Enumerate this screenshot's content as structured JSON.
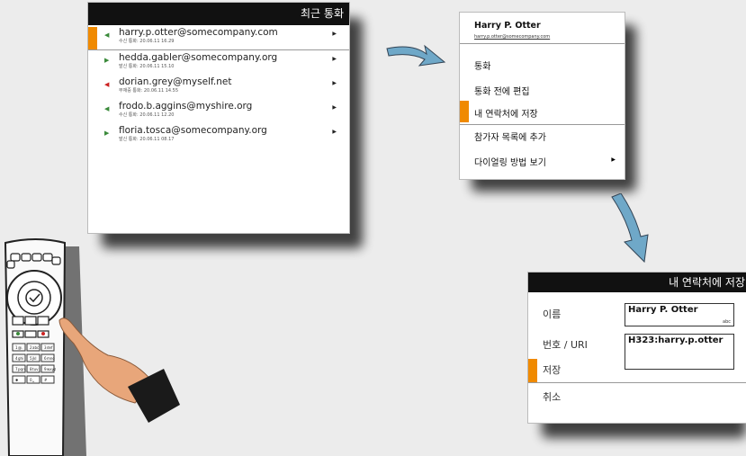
{
  "recent_calls": {
    "title": "최근 통화",
    "calls": [
      {
        "address": "harry.p.otter@somecompany.com",
        "detail": "수신 통화: 20.06.11 16.29",
        "status": "received",
        "arrow": "▶"
      },
      {
        "address": "hedda.gabler@somecompany.org",
        "detail": "발신 통화: 20.06.11 15.10",
        "status": "placed",
        "arrow": "▶"
      },
      {
        "address": "dorian.grey@myself.net",
        "detail": "부재중 통화: 20.06.11 14.55",
        "status": "missed",
        "arrow": "▶"
      },
      {
        "address": "frodo.b.aggins@myshire.org",
        "detail": "수신 통화: 20.06.11 12.20",
        "status": "received",
        "arrow": "▶"
      },
      {
        "address": "floria.tosca@somecompany.org",
        "detail": "발신 통화: 20.06.11 08.17",
        "status": "placed",
        "arrow": "▶"
      }
    ]
  },
  "context_menu": {
    "name": "Harry P. Otter",
    "email": "harry.p.otter@somecompany.com",
    "items": [
      {
        "label": "통화"
      },
      {
        "label": "통화 전에 편집"
      },
      {
        "label": "내 연락처에 저장"
      },
      {
        "label": "참가자 목록에 추가"
      },
      {
        "label": "다이얼링 방법 보기",
        "arrow": "▶"
      }
    ]
  },
  "save_contact": {
    "title": "내 연락처에 저장",
    "name_label": "이름",
    "name_value": "Harry P. Otter",
    "name_hint": "abc",
    "uri_label": "번호 / URI",
    "uri_value": "H323:harry.p.otter",
    "save_label": "저장",
    "cancel_label": "취소"
  },
  "colors": {
    "highlight": "#f08a00",
    "arrow": "#6fa8c8",
    "received": "#3a8a3a",
    "placed": "#3a8a3a",
    "missed": "#cc2222"
  },
  "remote": {
    "keys": [
      {
        "main": "1",
        "sub": "@."
      },
      {
        "main": "2",
        "sub": "abc"
      },
      {
        "main": "3",
        "sub": "def"
      },
      {
        "main": "4",
        "sub": "ghi"
      },
      {
        "main": "5",
        "sub": "jkl"
      },
      {
        "main": "6",
        "sub": "mno"
      },
      {
        "main": "7",
        "sub": "pqrs"
      },
      {
        "main": "8",
        "sub": "tuv"
      },
      {
        "main": "9",
        "sub": "wxyz"
      },
      {
        "main": "✱",
        "sub": ""
      },
      {
        "main": "0",
        "sub": "␣"
      },
      {
        "main": "#",
        "sub": ""
      }
    ]
  }
}
